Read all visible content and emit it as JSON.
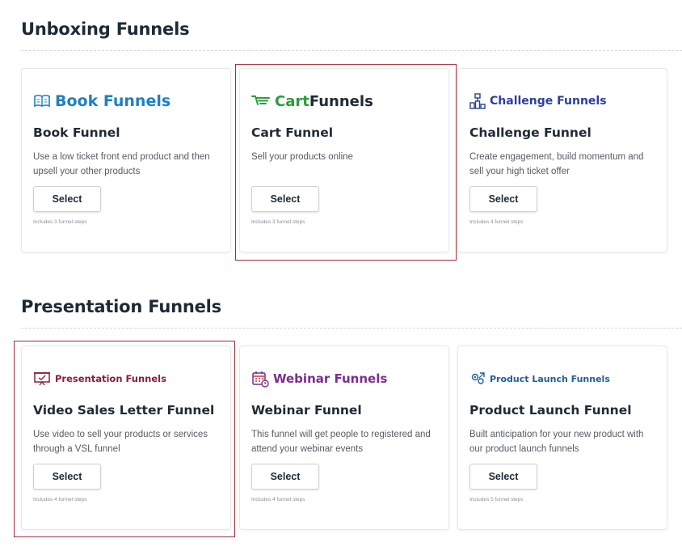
{
  "sections": [
    {
      "title": "Unboxing Funnels",
      "cards": [
        {
          "logo": {
            "icon": "book-icon",
            "text": "Book Funnels",
            "color": "#1f7fc4"
          },
          "title": "Book Funnel",
          "description": "Use a low ticket front end product and then upsell your other products",
          "button_label": "Select",
          "steps": "Includes 3 funnel steps"
        },
        {
          "logo": {
            "icon": "cart-icon",
            "text_a": "Cart",
            "text_b": "Funnels",
            "color_a": "#2a9d3a",
            "color_b": "#1e2a36"
          },
          "title": "Cart Funnel",
          "description": "Sell your products online",
          "button_label": "Select",
          "steps": "Includes 3 funnel steps"
        },
        {
          "logo": {
            "icon": "challenge-icon",
            "text": "Challenge Funnels",
            "color": "#2b3f9a"
          },
          "title": "Challenge Funnel",
          "description": "Create engagement, build momentum and sell your high ticket offer",
          "button_label": "Select",
          "steps": "Includes 4 funnel steps"
        }
      ]
    },
    {
      "title": "Presentation Funnels",
      "cards": [
        {
          "logo": {
            "icon": "presentation-icon",
            "text": "Presentation Funnels",
            "color": "#8a1f3a"
          },
          "title": "Video Sales Letter Funnel",
          "description": "Use video to sell your products or services through a VSL funnel",
          "button_label": "Select",
          "steps": "Includes 4 funnel steps"
        },
        {
          "logo": {
            "icon": "webinar-icon",
            "text": "Webinar Funnels",
            "color": "#7b2d8e"
          },
          "title": "Webinar Funnel",
          "description": "This funnel will get people to registered and attend your webinar events",
          "button_label": "Select",
          "steps": "Includes 4 funnel steps"
        },
        {
          "logo": {
            "icon": "rocket-icon",
            "text": "Product Launch Funnels",
            "color": "#1f5f9a"
          },
          "title": "Product Launch Funnel",
          "description": "Built anticipation for your new product with our product launch funnels",
          "button_label": "Select",
          "steps": "Includes 5 funnel steps"
        }
      ]
    }
  ],
  "highlight_color": "#a32b36"
}
